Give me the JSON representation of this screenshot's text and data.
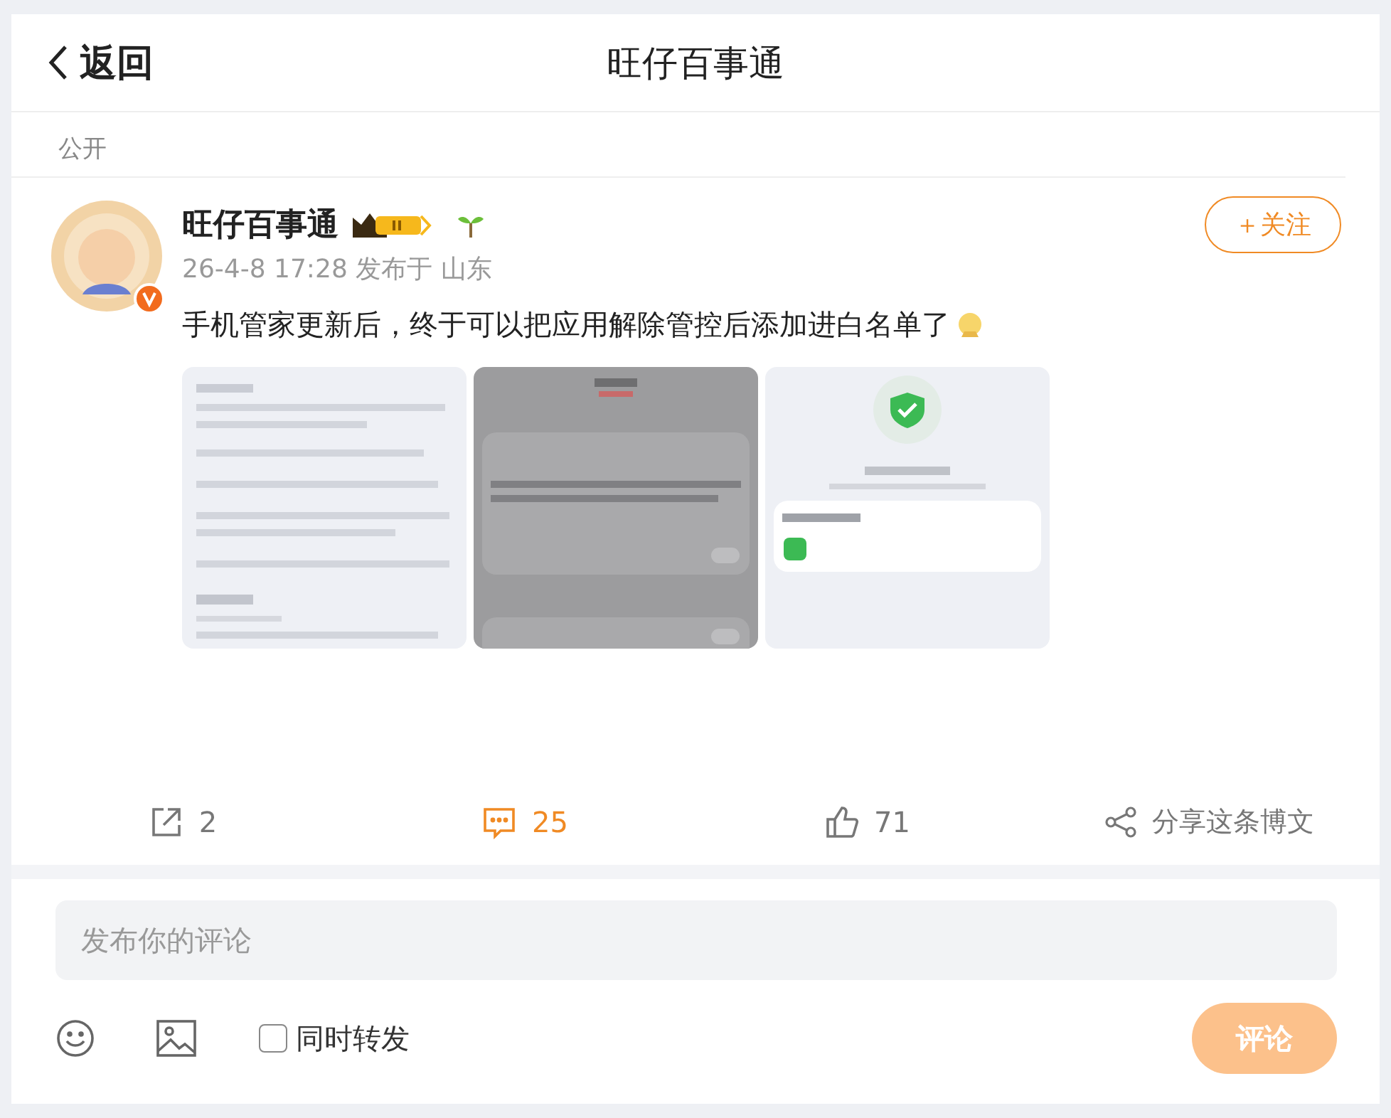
{
  "header": {
    "back": "返回",
    "title": "旺仔百事通"
  },
  "visibility": "公开",
  "post": {
    "author": "旺仔百事通",
    "verified": true,
    "meta": "26-4-8 17:28 发布于 山东",
    "follow": "＋关注",
    "text": "手机管家更新后，终于可以把应用解除管控后添加进白名单了"
  },
  "actions": [
    {
      "kind": "repost",
      "count": "2",
      "active": false
    },
    {
      "kind": "comment",
      "count": "25",
      "active": true
    },
    {
      "kind": "like",
      "count": "71",
      "active": false
    },
    {
      "kind": "share",
      "count": "分享这条博文",
      "active": false
    }
  ],
  "composer": {
    "placeholder": "发布你的评论",
    "repost": {
      "label": "同时转发",
      "checked": false
    },
    "submit": {
      "label": "评论",
      "disabled": true
    }
  }
}
